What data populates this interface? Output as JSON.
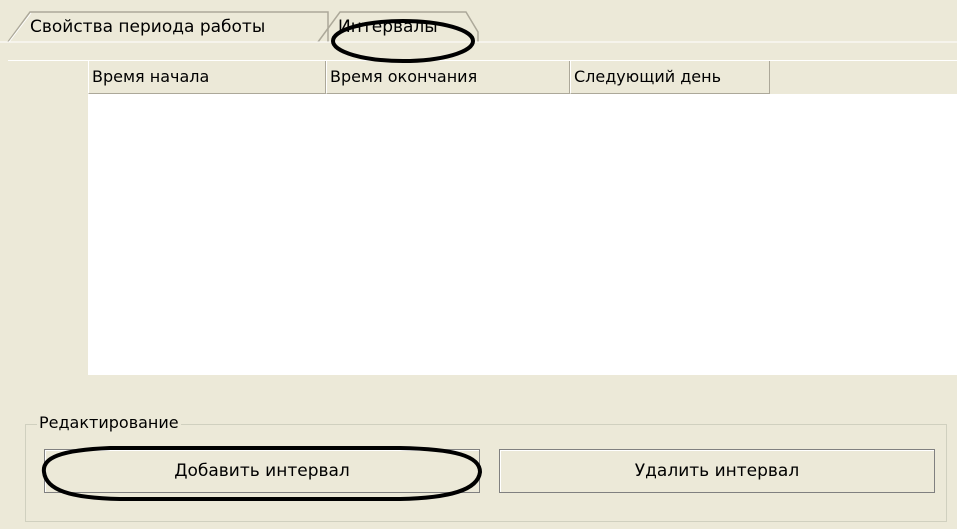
{
  "tabs": [
    {
      "label": "Свойства периода работы",
      "selected": false
    },
    {
      "label": "Интервалы",
      "selected": true
    }
  ],
  "grid": {
    "columns": [
      "Время начала",
      "Время окончания",
      "Следующий день"
    ],
    "rows": []
  },
  "editing": {
    "group_label": "Редактирование",
    "add_label": "Добавить интервал",
    "delete_label": "Удалить интервал"
  },
  "colors": {
    "background": "#ece9d8",
    "grid_area": "#ffffff",
    "highlight_ellipse": "#000000"
  }
}
